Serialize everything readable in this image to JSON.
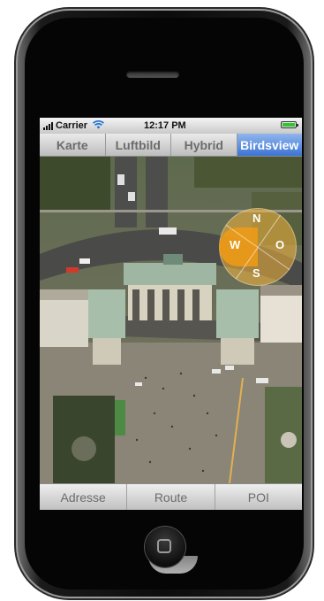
{
  "status_bar": {
    "carrier": "Carrier",
    "time": "12:17 PM",
    "battery_level": 1.0
  },
  "map_modes": {
    "selected_index": 3,
    "items": [
      {
        "label": "Karte"
      },
      {
        "label": "Luftbild"
      },
      {
        "label": "Hybrid"
      },
      {
        "label": "Birdsview"
      }
    ]
  },
  "compass": {
    "north": "N",
    "west": "W",
    "east": "O",
    "south": "S"
  },
  "bottom_tabs": [
    {
      "label": "Adresse"
    },
    {
      "label": "Route"
    },
    {
      "label": "POI"
    }
  ],
  "colors": {
    "active_segment": "#3c74d4",
    "compass": "#f5b43c",
    "battery": "#33c633"
  }
}
